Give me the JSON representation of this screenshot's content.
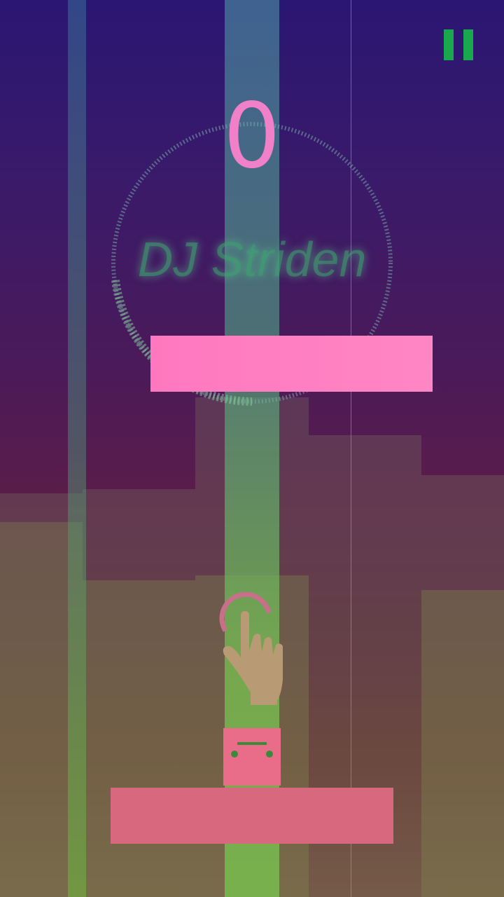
{
  "game": {
    "score": "0",
    "artist": "DJ Striden"
  },
  "colors": {
    "score": "#f080c8",
    "platform": "#ff7cc0",
    "pause": "#1aa84e",
    "beam": "#78c850"
  },
  "icons": {
    "pause": "pause-icon",
    "hand": "tap-hand-icon",
    "player": "boombox-icon"
  }
}
